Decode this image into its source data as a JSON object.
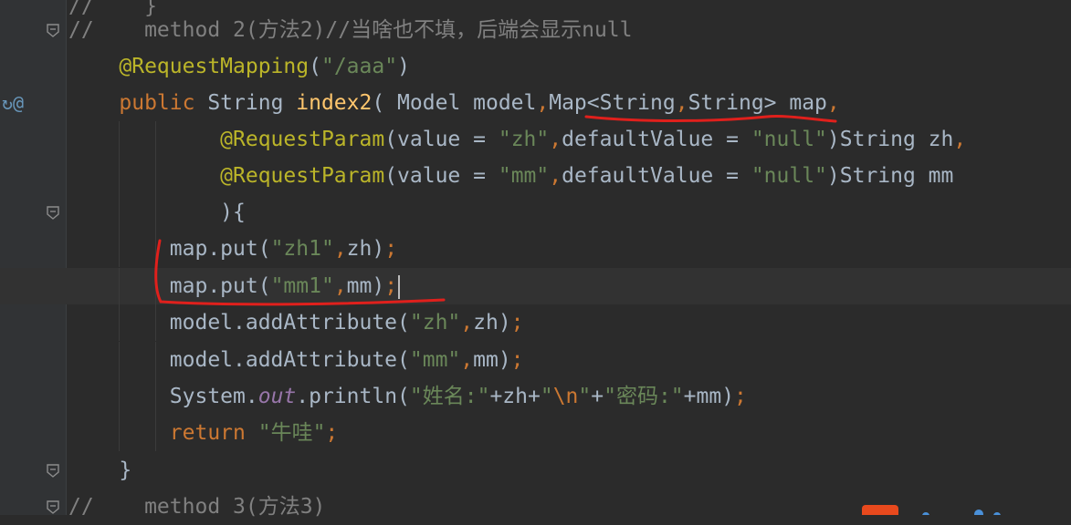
{
  "editor": {
    "lines": [
      {
        "id": "l0",
        "segments": [
          {
            "cls": "cmt",
            "text": "//    }"
          }
        ]
      },
      {
        "id": "l1",
        "segments": [
          {
            "cls": "cmt",
            "text": "//    method 2(方法2)//当啥也不填，后端会显示null"
          }
        ]
      },
      {
        "id": "l2",
        "segments": [
          {
            "cls": "",
            "text": "    "
          },
          {
            "cls": "ann",
            "text": "@RequestMapping"
          },
          {
            "cls": "",
            "text": "("
          },
          {
            "cls": "str",
            "text": "\"/aaa\""
          },
          {
            "cls": "",
            "text": ")"
          }
        ]
      },
      {
        "id": "l3",
        "segments": [
          {
            "cls": "",
            "text": "    "
          },
          {
            "cls": "kw",
            "text": "public "
          },
          {
            "cls": "",
            "text": "String "
          },
          {
            "cls": "fn",
            "text": "index2"
          },
          {
            "cls": "",
            "text": "( Model model"
          },
          {
            "cls": "kw",
            "text": ","
          },
          {
            "cls": "",
            "text": "Map<String"
          },
          {
            "cls": "kw",
            "text": ","
          },
          {
            "cls": "",
            "text": "String> map"
          },
          {
            "cls": "kw",
            "text": ","
          }
        ]
      },
      {
        "id": "l4",
        "segments": [
          {
            "cls": "",
            "text": "            "
          },
          {
            "cls": "ann",
            "text": "@RequestParam"
          },
          {
            "cls": "",
            "text": "("
          },
          {
            "cls": "pname",
            "text": "value"
          },
          {
            "cls": "",
            "text": " = "
          },
          {
            "cls": "str",
            "text": "\"zh\""
          },
          {
            "cls": "kw",
            "text": ","
          },
          {
            "cls": "pname",
            "text": "defaultValue"
          },
          {
            "cls": "",
            "text": " = "
          },
          {
            "cls": "str",
            "text": "\"null\""
          },
          {
            "cls": "",
            "text": ")String zh"
          },
          {
            "cls": "kw",
            "text": ","
          }
        ]
      },
      {
        "id": "l5",
        "segments": [
          {
            "cls": "",
            "text": "            "
          },
          {
            "cls": "ann",
            "text": "@RequestParam"
          },
          {
            "cls": "",
            "text": "("
          },
          {
            "cls": "pname",
            "text": "value"
          },
          {
            "cls": "",
            "text": " = "
          },
          {
            "cls": "str",
            "text": "\"mm\""
          },
          {
            "cls": "kw",
            "text": ","
          },
          {
            "cls": "pname",
            "text": "defaultValue"
          },
          {
            "cls": "",
            "text": " = "
          },
          {
            "cls": "str",
            "text": "\"null\""
          },
          {
            "cls": "",
            "text": ")String mm"
          }
        ]
      },
      {
        "id": "l6",
        "segments": [
          {
            "cls": "",
            "text": "            ){"
          }
        ]
      },
      {
        "id": "l7",
        "segments": [
          {
            "cls": "",
            "text": "        map.put("
          },
          {
            "cls": "str",
            "text": "\"zh1\""
          },
          {
            "cls": "kw",
            "text": ","
          },
          {
            "cls": "",
            "text": "zh)"
          },
          {
            "cls": "kw",
            "text": ";"
          }
        ]
      },
      {
        "id": "l8",
        "segments": [
          {
            "cls": "",
            "text": "        map.put("
          },
          {
            "cls": "str",
            "text": "\"mm1\""
          },
          {
            "cls": "kw",
            "text": ","
          },
          {
            "cls": "",
            "text": "mm)"
          },
          {
            "cls": "kw",
            "text": ";"
          }
        ]
      },
      {
        "id": "l9",
        "segments": [
          {
            "cls": "",
            "text": "        model.addAttribute("
          },
          {
            "cls": "str",
            "text": "\"zh\""
          },
          {
            "cls": "kw",
            "text": ","
          },
          {
            "cls": "",
            "text": "zh)"
          },
          {
            "cls": "kw",
            "text": ";"
          }
        ]
      },
      {
        "id": "l10",
        "segments": [
          {
            "cls": "",
            "text": "        model.addAttribute("
          },
          {
            "cls": "str",
            "text": "\"mm\""
          },
          {
            "cls": "kw",
            "text": ","
          },
          {
            "cls": "",
            "text": "mm)"
          },
          {
            "cls": "kw",
            "text": ";"
          }
        ]
      },
      {
        "id": "l11",
        "segments": [
          {
            "cls": "",
            "text": "        System."
          },
          {
            "cls": "fld",
            "text": "out"
          },
          {
            "cls": "",
            "text": ".println("
          },
          {
            "cls": "str",
            "text": "\"姓名:\""
          },
          {
            "cls": "",
            "text": "+zh+"
          },
          {
            "cls": "str",
            "text": "\""
          },
          {
            "cls": "esc",
            "text": "\\n"
          },
          {
            "cls": "str",
            "text": "\""
          },
          {
            "cls": "",
            "text": "+"
          },
          {
            "cls": "str",
            "text": "\"密码:\""
          },
          {
            "cls": "",
            "text": "+mm)"
          },
          {
            "cls": "kw",
            "text": ";"
          }
        ]
      },
      {
        "id": "l12",
        "segments": [
          {
            "cls": "",
            "text": "        "
          },
          {
            "cls": "kw",
            "text": "return "
          },
          {
            "cls": "str",
            "text": "\"牛哇\""
          },
          {
            "cls": "kw",
            "text": ";"
          }
        ]
      },
      {
        "id": "l13",
        "segments": [
          {
            "cls": "",
            "text": "    }"
          }
        ]
      },
      {
        "id": "l14",
        "segments": [
          {
            "cls": "cmt",
            "text": "//    method 3(方法3)"
          }
        ]
      }
    ],
    "gutter_marks": {
      "l3": "@"
    },
    "folds": [
      "l1",
      "l6",
      "l13",
      "l14"
    ],
    "current_line": "l8"
  },
  "colors": {
    "background": "#2b2b2b",
    "gutter": "#313335",
    "annotation_pen": "#e0201c",
    "keyword": "#cc7832",
    "string": "#6a8759",
    "annotation": "#bbb529",
    "method_decl": "#ffc66d",
    "comment": "#808080"
  }
}
